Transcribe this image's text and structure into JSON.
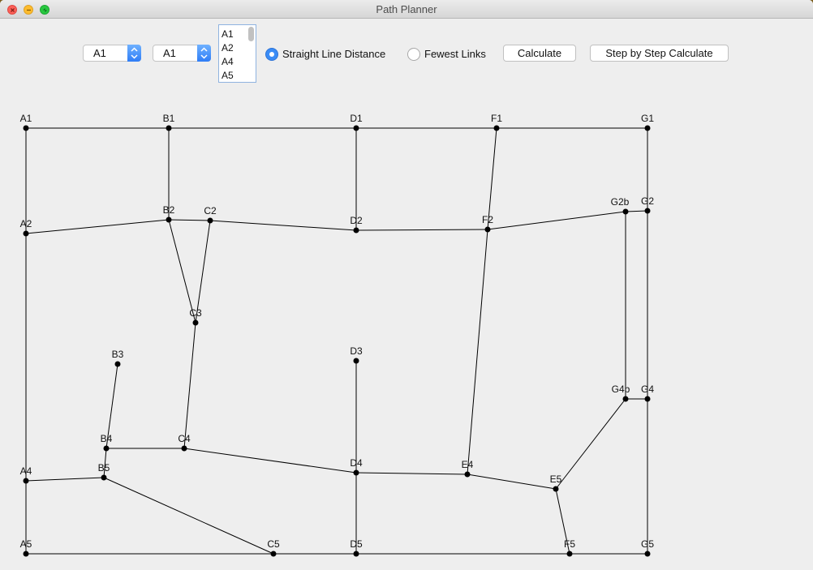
{
  "window": {
    "title": "Path Planner"
  },
  "controls": {
    "from_value": "A1",
    "to_value": "A1",
    "list_items": [
      "A1",
      "A2",
      "A4",
      "A5"
    ],
    "radio_straight_label": "Straight Line Distance",
    "radio_fewest_label": "Fewest Links",
    "selected_mode": "Straight Line Distance",
    "calculate_label": "Calculate",
    "step_label": "Step by Step Calculate"
  },
  "graph": {
    "nodes": [
      "A1",
      "B1",
      "D1",
      "F1",
      "G1",
      "A2",
      "B2",
      "C2",
      "D2",
      "F2",
      "G2b",
      "G2",
      "C3",
      "B3",
      "D3",
      "G4b",
      "G4",
      "B4",
      "C4",
      "A4",
      "B5",
      "D4",
      "E4",
      "E5",
      "A5",
      "C5",
      "D5",
      "F5",
      "G5"
    ],
    "edges": [
      [
        "A1",
        "B1"
      ],
      [
        "B1",
        "D1"
      ],
      [
        "D1",
        "F1"
      ],
      [
        "F1",
        "G1"
      ],
      [
        "A1",
        "A2"
      ],
      [
        "B1",
        "B2"
      ],
      [
        "D1",
        "D2"
      ],
      [
        "F1",
        "F2"
      ],
      [
        "G1",
        "G2"
      ],
      [
        "A2",
        "B2"
      ],
      [
        "B2",
        "C2"
      ],
      [
        "C2",
        "D2"
      ],
      [
        "D2",
        "F2"
      ],
      [
        "F2",
        "G2b"
      ],
      [
        "G2b",
        "G2"
      ],
      [
        "B2",
        "C3"
      ],
      [
        "C2",
        "C3"
      ],
      [
        "C3",
        "C4"
      ],
      [
        "G2b",
        "G4b"
      ],
      [
        "G2",
        "G4"
      ],
      [
        "G4b",
        "G4"
      ],
      [
        "B3",
        "B4"
      ],
      [
        "B4",
        "C4"
      ],
      [
        "B4",
        "B5"
      ],
      [
        "C4",
        "D4"
      ],
      [
        "A2",
        "A4"
      ],
      [
        "A4",
        "B5"
      ],
      [
        "A4",
        "A5"
      ],
      [
        "B5",
        "C5"
      ],
      [
        "D3",
        "D4"
      ],
      [
        "D4",
        "E4"
      ],
      [
        "F2",
        "E4"
      ],
      [
        "E4",
        "E5"
      ],
      [
        "E5",
        "G4b"
      ],
      [
        "D4",
        "D5"
      ],
      [
        "E5",
        "F5"
      ],
      [
        "G4",
        "G5"
      ],
      [
        "A5",
        "C5"
      ],
      [
        "C5",
        "D5"
      ],
      [
        "D5",
        "F5"
      ],
      [
        "F5",
        "G5"
      ]
    ]
  },
  "colors": {
    "accent": "#3a8cf6",
    "edge": "#000000",
    "node": "#000000"
  },
  "icons": {
    "close": "close-icon",
    "minimize": "minimize-icon",
    "maximize": "maximize-icon",
    "stepper": "chevron-updown-icon"
  }
}
